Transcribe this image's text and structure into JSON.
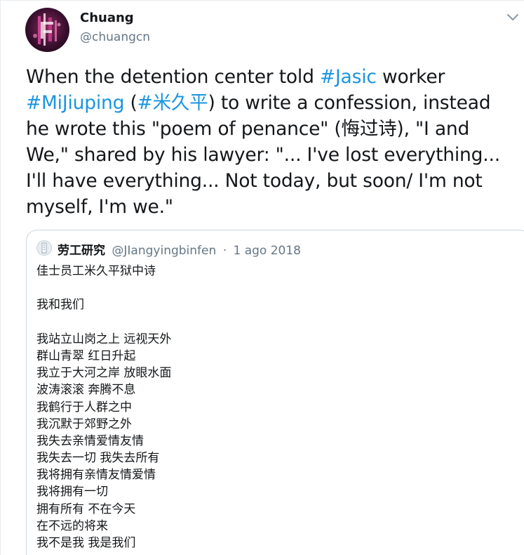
{
  "author": {
    "name": "Chuang",
    "handle": "@chuangcn"
  },
  "tweet": {
    "t1": "When the detention center told ",
    "tag_jasic": "#Jasic",
    "t2": " worker ",
    "tag_mijiuping": "#MiJiuping",
    "t3": " (",
    "tag_cn": "#米久平",
    "t4": ") to write a confession, instead he wrote this \"poem of penance\" (悔过诗), \"I and We,\" shared by his lawyer: \"... I've lost everything... I'll have everything... Not today, but soon/ I'm not myself, I'm we.\""
  },
  "quoted": {
    "name": "劳工研究",
    "handle": "@JIangyingbinfen",
    "separator": "·",
    "date": "1 ago 2018",
    "lines": [
      "佳士员工米久平狱中诗",
      "",
      "我和我们",
      "",
      "我站立山岗之上 远视天外",
      "群山青翠 红日升起",
      "我立于大河之岸 放眼水面",
      "波涛滚滚 奔腾不息",
      "我鹤行于人群之中",
      "我沉默于郊野之外",
      "我失去亲情爱情友情",
      "我失去一切 我失去所有",
      "我将拥有亲情友情爱情",
      "我将拥有一切",
      "拥有所有 不在今天",
      "在不远的将来",
      "我不是我 我是我们"
    ]
  },
  "icons": {
    "avatar": "avatar-image",
    "more": "chevron-down-icon",
    "quoted_avatar": "quoted-avatar-image"
  },
  "colors": {
    "link": "#1b95e0",
    "secondary": "#657786",
    "border": "#ccd6dd"
  }
}
